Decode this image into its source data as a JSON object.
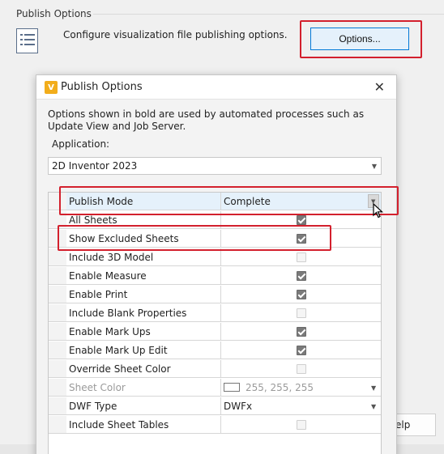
{
  "group": {
    "title": "Publish Options",
    "description": "Configure visualization file publishing options.",
    "options_button": "Options..."
  },
  "dialog": {
    "title": "Publish Options",
    "app_icon_letter": "V",
    "close_glyph": "✕",
    "description": "Options shown in bold are used by automated processes such as Update View and Job Server.",
    "application_label": "Application:",
    "application_value": "2D Inventor 2023",
    "rows": [
      {
        "name": "Publish Mode",
        "value": "Complete"
      },
      {
        "name": "All Sheets"
      },
      {
        "name": "Show Excluded Sheets"
      },
      {
        "name": "Include 3D Model"
      },
      {
        "name": "Enable Measure"
      },
      {
        "name": "Enable Print"
      },
      {
        "name": "Include Blank Properties"
      },
      {
        "name": "Enable Mark Ups"
      },
      {
        "name": "Enable Mark Up Edit"
      },
      {
        "name": "Override Sheet Color"
      },
      {
        "name": "Sheet Color",
        "value": "255, 255, 255"
      },
      {
        "name": "DWF Type",
        "value": "DWFx"
      },
      {
        "name": "Include Sheet Tables"
      }
    ]
  },
  "help_button_partial": "elp",
  "colors": {
    "accent_blue": "#0078d7",
    "highlight_red": "#d3202d",
    "selected_row": "#e5f1fb"
  }
}
